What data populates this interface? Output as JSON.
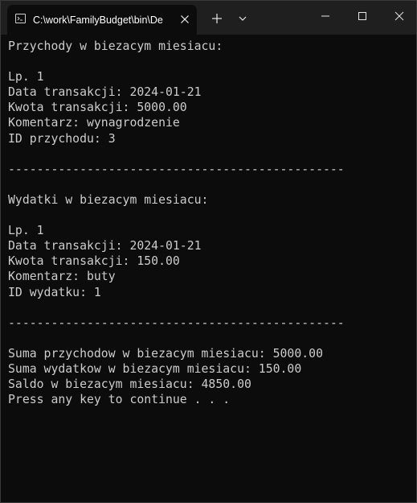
{
  "window": {
    "tab_title": "C:\\work\\FamilyBudget\\bin\\De"
  },
  "console": {
    "lines": [
      "Przychody w biezacym miesiacu:",
      "",
      "Lp. 1",
      "Data transakcji: 2024-01-21",
      "Kwota transakcji: 5000.00",
      "Komentarz: wynagrodzenie",
      "ID przychodu: 3",
      "",
      "-----------------------------------------------",
      "",
      "Wydatki w biezacym miesiacu:",
      "",
      "Lp. 1",
      "Data transakcji: 2024-01-21",
      "Kwota transakcji: 150.00",
      "Komentarz: buty",
      "ID wydatku: 1",
      "",
      "-----------------------------------------------",
      "",
      "Suma przychodow w biezacym miesiacu: 5000.00",
      "Suma wydatkow w biezacym miesiacu: 150.00",
      "Saldo w biezacym miesiacu: 4850.00",
      "Press any key to continue . . ."
    ]
  },
  "icons": {
    "tab": "console-icon",
    "tab_close": "close-icon",
    "new_tab": "plus-icon",
    "dropdown": "chevron-down-icon",
    "minimize": "minimize-icon",
    "maximize": "maximize-icon",
    "close": "close-icon"
  },
  "colors": {
    "background": "#0c0c0c",
    "titlebar": "#1f1f1f",
    "text": "#cccccc",
    "title_text": "#ffffff"
  }
}
